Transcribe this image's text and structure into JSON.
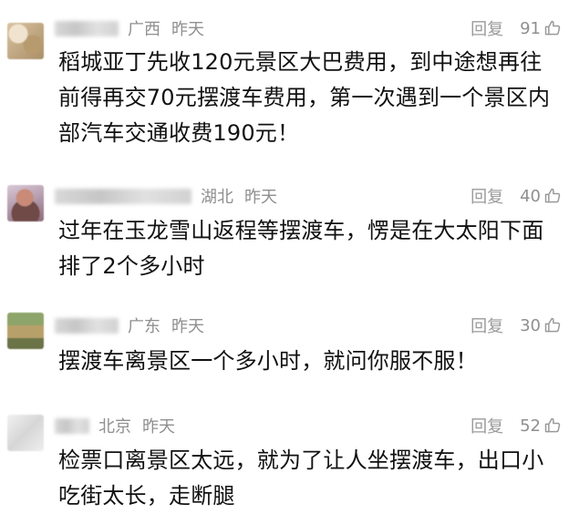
{
  "comments": [
    {
      "location": "广西",
      "time": "昨天",
      "reply_label": "回复",
      "likes": "91",
      "text": "稻城亚丁先收120元景区大巴费用，到中途想再往前得再交70元摆渡车费用，第一次遇到一个景区内部汽车交通收费190元！"
    },
    {
      "location": "湖北",
      "time": "昨天",
      "reply_label": "回复",
      "likes": "40",
      "text": "过年在玉龙雪山返程等摆渡车，愣是在大太阳下面排了2个多小时"
    },
    {
      "location": "广东",
      "time": "昨天",
      "reply_label": "回复",
      "likes": "30",
      "text": "摆渡车离景区一个多小时，就问你服不服！"
    },
    {
      "location": "北京",
      "time": "昨天",
      "reply_label": "回复",
      "likes": "52",
      "text": "检票口离景区太远，就为了让人坐摆渡车，出口小吃街太长，走断腿"
    }
  ],
  "icons": {
    "like": "thumbs-up-icon"
  },
  "colors": {
    "background": "#ffffff",
    "meta": "#8f8f8f",
    "text": "#111111"
  }
}
